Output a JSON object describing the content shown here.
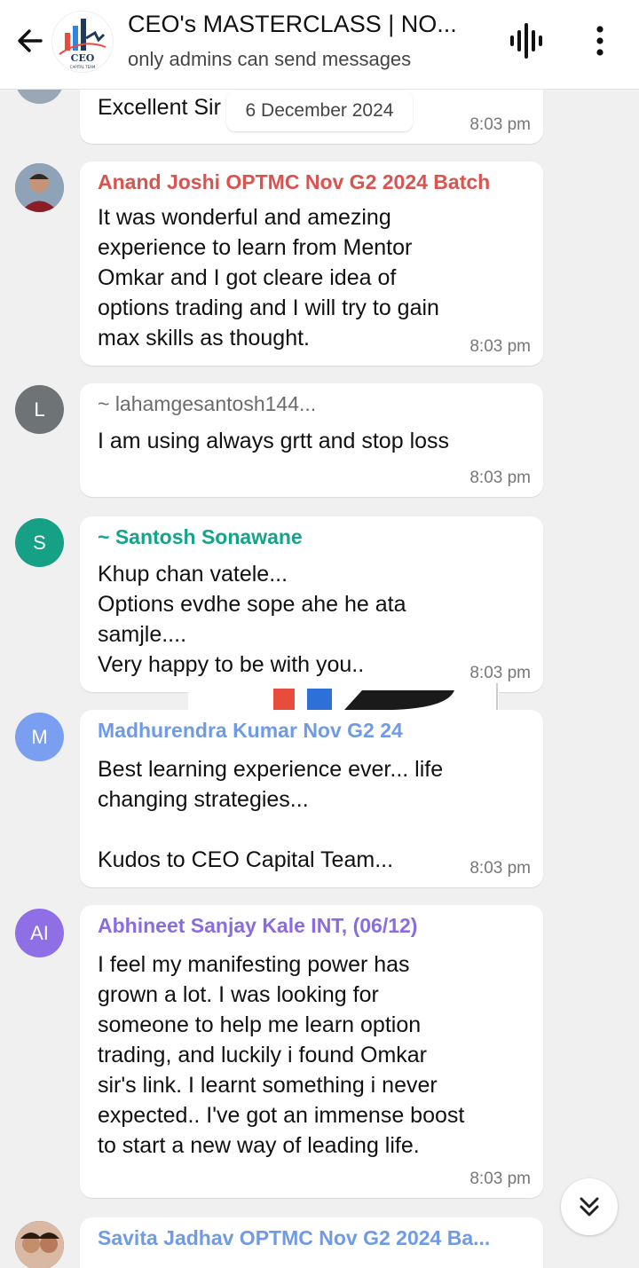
{
  "header": {
    "title": "CEO's MASTERCLASS | NO...",
    "subtitle": "only admins can send messages",
    "logo_text": "CEO",
    "logo_subtext": "CAPITAL TEAM"
  },
  "date_chip": "6 December 2024",
  "messages": [
    {
      "sender": "",
      "sender_color": "#000000",
      "text": "Excellent Sir",
      "time": "8:03 pm",
      "avatar_letter": "",
      "avatar_color": "#9aa7b5"
    },
    {
      "sender": "Anand Joshi OPTMC Nov G2 2024 Batch",
      "sender_color": "#d9534f",
      "text": "It was wonderful and amezing\nexperience to learn from Mentor\nOmkar and I got cleare idea of\noptions trading and I will try to gain\nmax skills as thought.",
      "time": "8:03 pm",
      "avatar_letter": "",
      "avatar_color": "#7a4b3a"
    },
    {
      "sender": "~ lahamgesantosh144...",
      "sender_color": "#6b6b6b",
      "text": "I am using always grtt and stop loss",
      "time": "8:03 pm",
      "avatar_letter": "L",
      "avatar_color": "#6e7376"
    },
    {
      "sender": "~ Santosh Sonawane",
      "sender_color": "#14a38b",
      "text": "Khup chan vatele...\nOptions evdhe sope ahe he ata\nsamjle....\nVery happy to be with you..",
      "time": "8:03 pm",
      "avatar_letter": "S",
      "avatar_color": "#16a085"
    },
    {
      "sender": "Madhurendra Kumar Nov G2 24",
      "sender_color": "#6f9be6",
      "text": "Best learning experience ever... life\nchanging strategies...\n\nKudos to CEO Capital Team...",
      "time": "8:03 pm",
      "avatar_letter": "M",
      "avatar_color": "#7b9ff0"
    },
    {
      "sender": "Abhineet Sanjay Kale INT, (06/12)",
      "sender_color": "#8a6ce0",
      "text": "I feel my manifesting power has\ngrown a lot. I was looking for\nsomeone to help me learn option\ntrading, and luckily i found Omkar\nsir's link. I learnt something i never\nexpected.. I've got an immense boost\nto start a new way of leading life.",
      "time": "8:03 pm",
      "avatar_letter": "AI",
      "avatar_color": "#8e6fe6"
    },
    {
      "sender": "Savita Jadhav OPTMC Nov G2 2024 Ba...",
      "sender_color": "#6f9be6",
      "text": "",
      "time": "",
      "avatar_letter": "",
      "avatar_color": "#5a3b32"
    }
  ]
}
